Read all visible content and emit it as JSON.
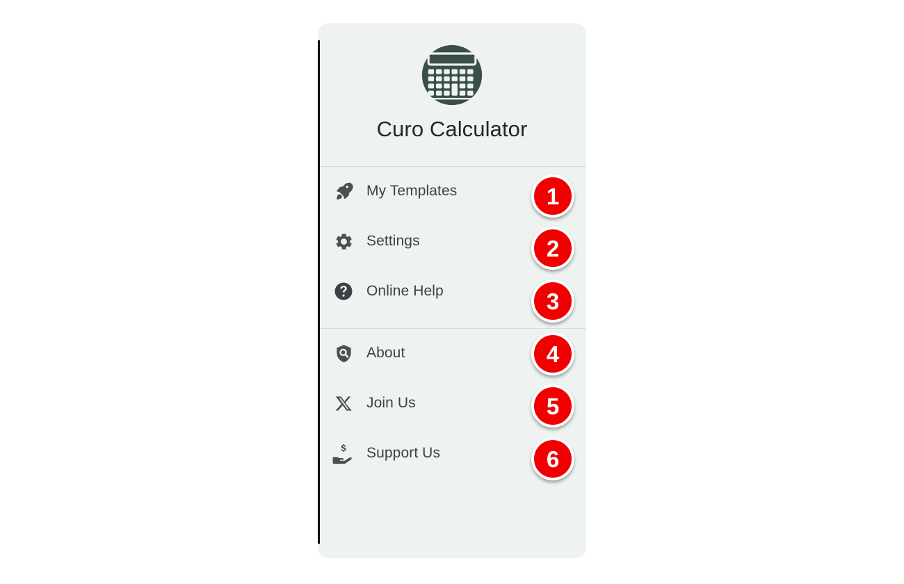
{
  "app": {
    "title": "Curo Calculator",
    "logo_icon": "calculator-circle-icon",
    "panel_bg": "#eef3f1",
    "logo_color": "#3a4f48",
    "text_color": "#3b4245",
    "badge_color": "#f00000",
    "badge_text_color": "#ffffff"
  },
  "menu": {
    "primary": [
      {
        "label": "My Templates",
        "icon": "rocket-icon",
        "badge": "1"
      },
      {
        "label": "Settings",
        "icon": "gear-icon",
        "badge": "2"
      },
      {
        "label": "Online Help",
        "icon": "help-circle-icon",
        "badge": "3"
      }
    ],
    "secondary": [
      {
        "label": "About",
        "icon": "shield-search-icon",
        "badge": "4"
      },
      {
        "label": "Join Us",
        "icon": "x-twitter-icon",
        "badge": "5"
      },
      {
        "label": "Support Us",
        "icon": "hand-dollar-icon",
        "badge": "6"
      }
    ]
  }
}
